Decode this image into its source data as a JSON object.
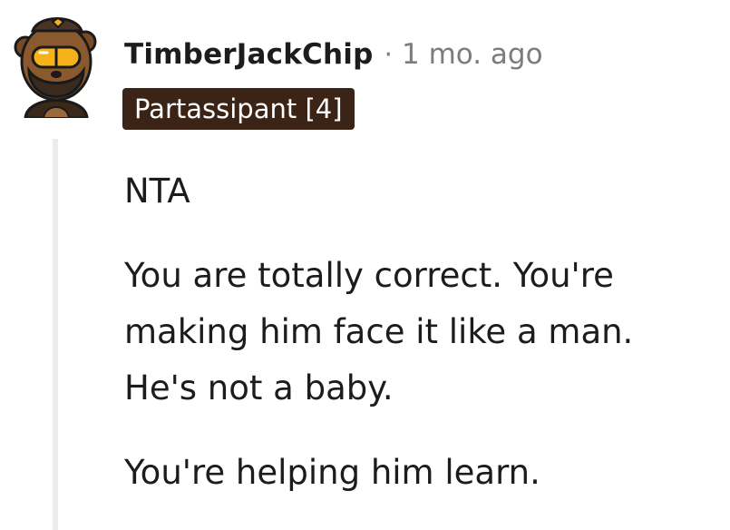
{
  "comment": {
    "avatar_icon": "user-avatar-icon",
    "username": "TimberJackChip",
    "separator": "·",
    "timestamp": "1 mo. ago",
    "flair": "Partassipant [4]",
    "paragraphs": [
      "NTA",
      "You are totally correct. You're making him face it like a man. He's not a baby.",
      "You're helping him learn."
    ]
  },
  "colors": {
    "flair_background": "#3b2316",
    "flair_text": "#ffffff",
    "meta_text": "#7c7c7c",
    "body_text": "#1c1c1c",
    "thread_line": "#ececec"
  }
}
